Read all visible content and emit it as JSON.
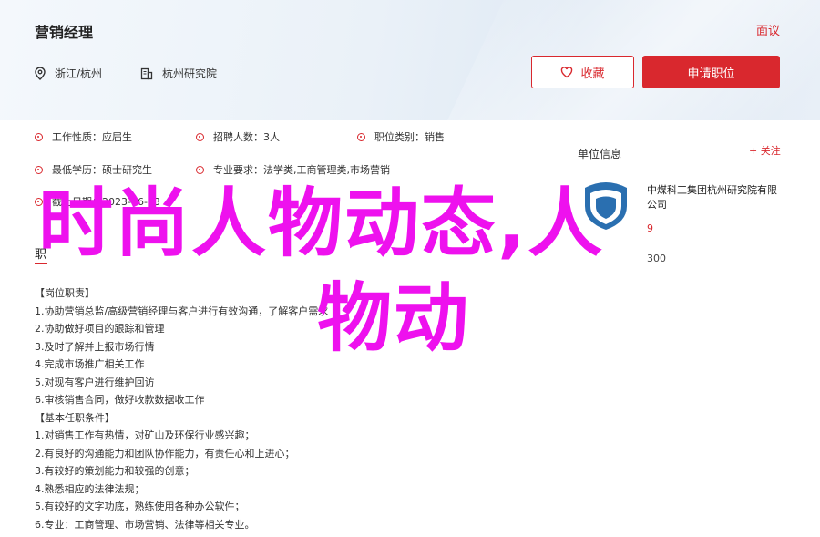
{
  "header": {
    "title": "营销经理",
    "back_label": "面议",
    "location": "浙江/杭州",
    "company": "杭州研究院",
    "favorite_label": "收藏",
    "apply_label": "申请职位"
  },
  "info": {
    "job_type": "工作性质：应届生",
    "headcount": "招聘人数：3人",
    "category": "职位类别：销售",
    "education": "最低学历：硕士研究生",
    "major": "专业要求：法学类,工商管理类,市场营销",
    "deadline": "截止日期：2023-06-13",
    "deadline_partial": "截止"
  },
  "sections": {
    "duty_title": "职位描述",
    "duty_title_partial": "职"
  },
  "description": [
    "【岗位职责】",
    "1.协助营销总监/高级营销经理与客户进行有效沟通，了解客户需求",
    "2.协助做好项目的跟踪和管理",
    "3.及时了解并上报市场行情",
    "4.完成市场推广相关工作",
    "5.对现有客户进行维护回访",
    "6.审核销售合同，做好收款数据收工作",
    "【基本任职条件】",
    "1.对销售工作有热情，对矿山及环保行业感兴趣；",
    "2.有良好的沟通能力和团队协作能力，有责任心和上进心；",
    "3.有较好的策划能力和较强的创意；",
    "4.熟悉相应的法律法规；",
    "5.有较好的文字功底，熟练使用各种办公软件；",
    "6.专业：工商管理、市场营销、法律等相关专业。"
  ],
  "unit": {
    "title": "单位信息",
    "follow_label": "+ 关注",
    "name": "中煤科工集团杭州研究院有限公司",
    "score": "9",
    "meta_partial": "300"
  },
  "overlay": {
    "line1": "时尚人物动态,人",
    "line2": "物动"
  },
  "colors": {
    "accent": "#d9282e",
    "overlay": "#ee11ee"
  }
}
